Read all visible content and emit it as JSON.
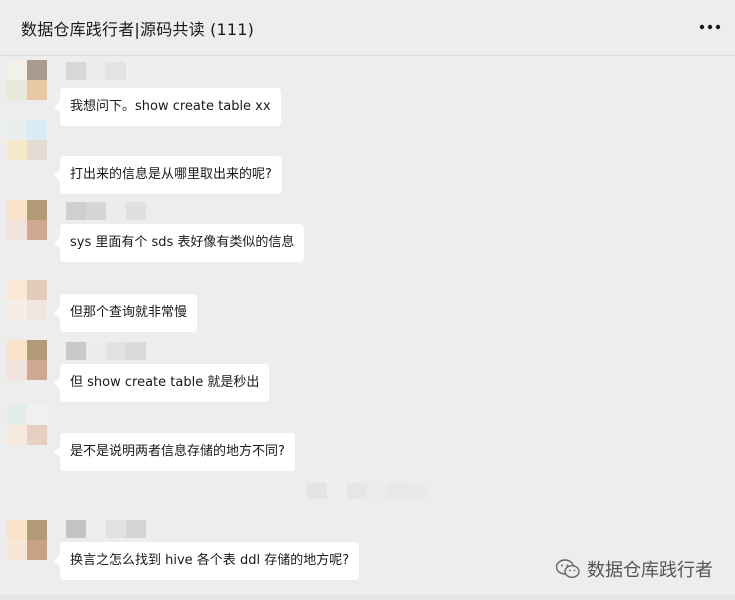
{
  "header": {
    "title": "数据仓库践行者|源码共读 (111)",
    "more_icon": "more-icon"
  },
  "messages": [
    {
      "text": "我想问下。show create table xx",
      "has_name": true
    },
    {
      "text": "打出来的信息是从哪里取出来的呢?",
      "has_name": false
    },
    {
      "text": "sys 里面有个 sds 表好像有类似的信息",
      "has_name": true
    },
    {
      "text": "但那个查询就非常慢",
      "has_name": false
    },
    {
      "text": "但 show create table 就是秒出",
      "has_name": true
    },
    {
      "text": "是不是说明两者信息存储的地方不同?",
      "has_name": false
    },
    {
      "text": "换言之怎么找到 hive 各个表 ddl 存储的地方呢?",
      "has_name": true
    }
  ],
  "watermark": {
    "icon": "wechat-icon",
    "text": "数据仓库践行者"
  },
  "colors": {
    "background": "#ededed",
    "bubble": "#ffffff"
  }
}
